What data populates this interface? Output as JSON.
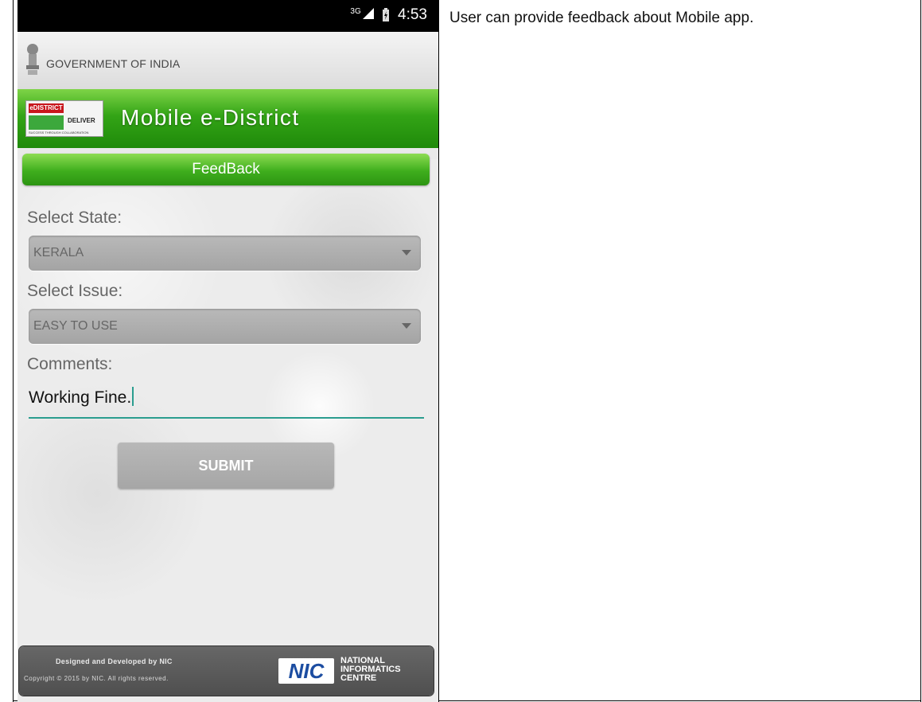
{
  "status_bar": {
    "network": "3G",
    "time": "4:53"
  },
  "gov_bar": {
    "title": "GOVERNMENT OF INDIA"
  },
  "header": {
    "logo_brand": "eDISTRICT",
    "logo_deliver": "DELIVER",
    "logo_tagline": "SUCCESS THROUGH COLLABORATION",
    "app_title": "Mobile e-District"
  },
  "feedback_bar": {
    "label": "FeedBack"
  },
  "form": {
    "state_label": "Select State:",
    "state_value": "KERALA",
    "issue_label": "Select Issue:",
    "issue_value": "EASY TO USE",
    "comments_label": "Comments:",
    "comments_value": "Working Fine."
  },
  "submit": {
    "label": "SUBMIT"
  },
  "footer": {
    "designed_by": "Designed and Developed by NIC",
    "copyright": "Copyright © 2015 by NIC. All rights reserved.",
    "nic_logo": "NIC",
    "nic_name_1": "NATIONAL",
    "nic_name_2": "INFORMATICS",
    "nic_name_3": "CENTRE"
  },
  "description": "User can provide feedback about Mobile app.",
  "colors": {
    "accent_green": "#33a416",
    "input_underline": "#2a9d8f"
  },
  "icons": [
    "signal-icon",
    "battery-icon",
    "emblem-icon",
    "dropdown-caret-icon"
  ]
}
